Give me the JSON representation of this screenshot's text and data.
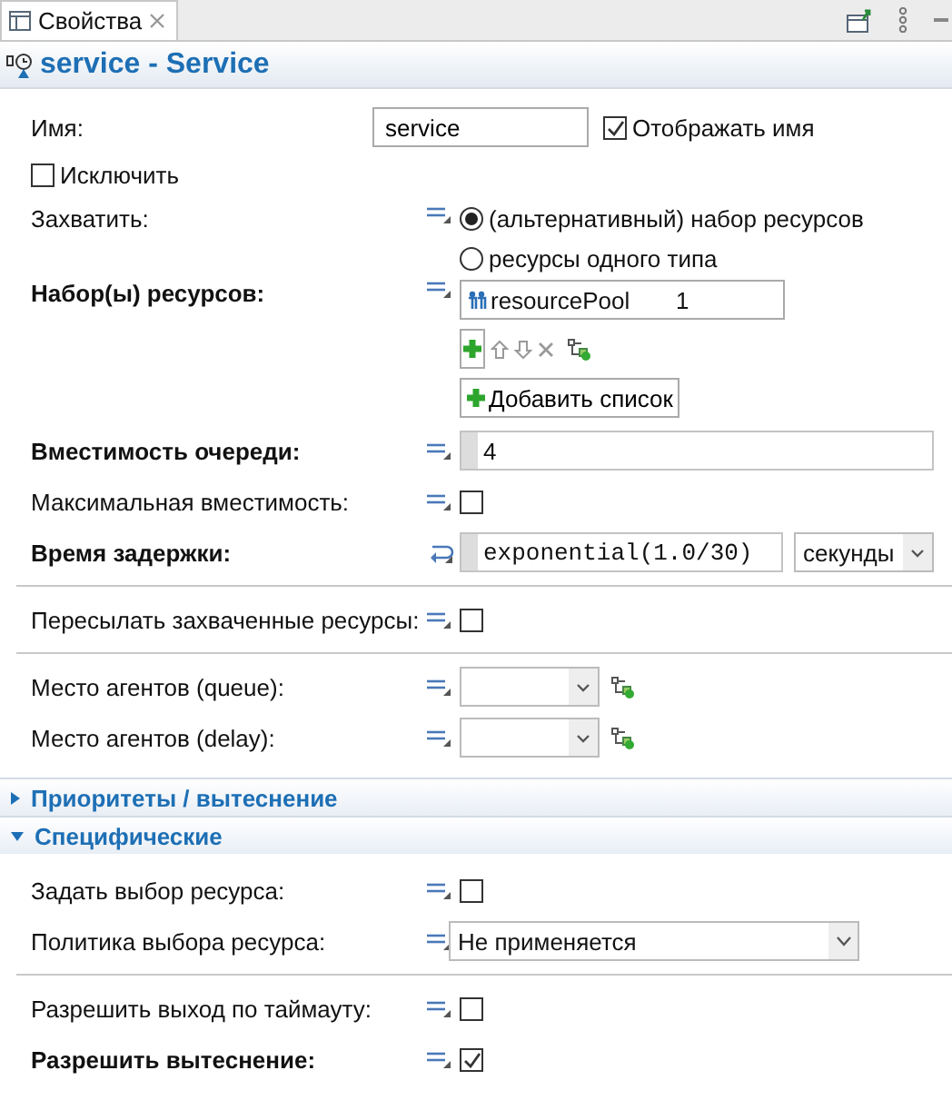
{
  "tab": {
    "label": "Свойства"
  },
  "header": {
    "title": "service - Service"
  },
  "name_row": {
    "label": "Имя:",
    "value": "service",
    "show_name": {
      "label": "Отображать имя",
      "checked": true
    }
  },
  "exclude": {
    "label": "Исключить",
    "checked": false
  },
  "rows": [
    {
      "kind": "radio",
      "label": "Захватить:",
      "bold": false,
      "dynamic": false,
      "options": [
        {
          "label": "(альтернативный) набор ресурсов",
          "selected": true
        },
        {
          "label": "ресурсы одного типа",
          "selected": false
        }
      ]
    },
    {
      "kind": "resource_table",
      "label": "Набор(ы) ресурсов:",
      "bold": true,
      "dynamic": false,
      "cells": [
        {
          "name": "resourcePool",
          "count": "1"
        }
      ],
      "add_button": "Добавить список"
    },
    {
      "kind": "number",
      "label": "Вместимость очереди:",
      "bold": true,
      "dynamic": false,
      "value": "4"
    },
    {
      "kind": "checkbox",
      "label": "Максимальная вместимость:",
      "bold": false,
      "dynamic": false,
      "checked": false
    },
    {
      "kind": "code",
      "label": "Время задержки:",
      "bold": true,
      "dynamic": true,
      "value": "exponential(1.0/30)",
      "unit": "секунды"
    },
    {
      "kind": "separator"
    },
    {
      "kind": "checkbox",
      "label": "Пересылать захваченные ресурсы:",
      "bold": false,
      "dynamic": false,
      "checked": false
    },
    {
      "kind": "separator"
    },
    {
      "kind": "place",
      "label": "Место агентов (queue):",
      "bold": false,
      "dynamic": false
    },
    {
      "kind": "place",
      "label": "Место агентов (delay):",
      "bold": false,
      "dynamic": false
    }
  ],
  "sections": [
    {
      "title": "Приоритеты / вытеснение",
      "expanded": false
    },
    {
      "title": "Специфические",
      "expanded": true,
      "rows": [
        {
          "kind": "checkbox",
          "label": "Задать выбор ресурса:",
          "bold": false,
          "dynamic": false,
          "checked": false
        },
        {
          "kind": "dropdown",
          "label": "Политика выбора ресурса:",
          "bold": false,
          "dynamic": false,
          "value": "Не применяется"
        },
        {
          "kind": "separator"
        },
        {
          "kind": "checkbox",
          "label": "Разрешить выход по таймауту:",
          "bold": false,
          "dynamic": false,
          "checked": false
        },
        {
          "kind": "checkbox",
          "label": "Разрешить вытеснение:",
          "bold": true,
          "dynamic": false,
          "checked": true
        }
      ]
    }
  ]
}
